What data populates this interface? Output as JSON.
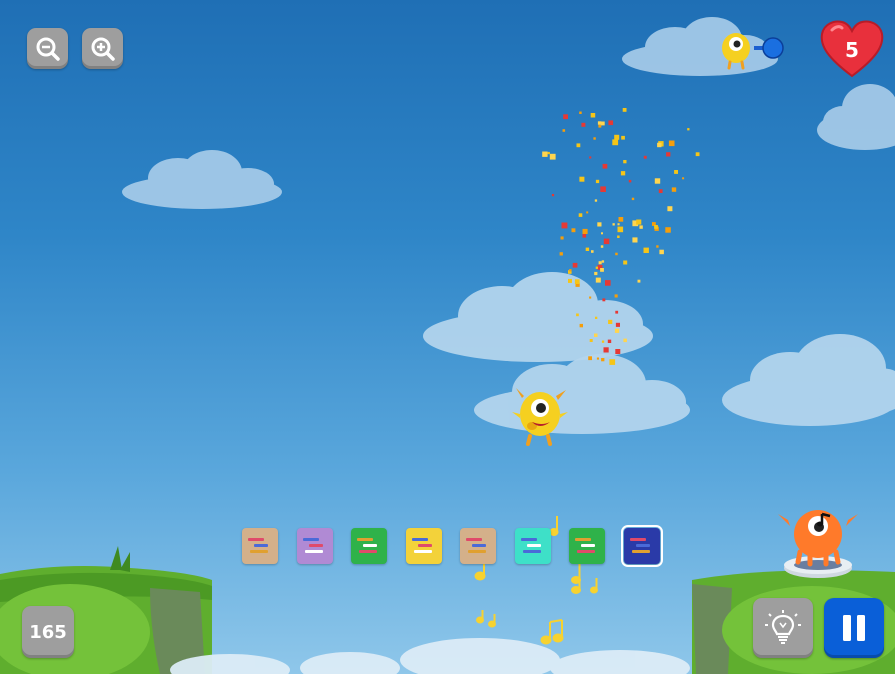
{
  "hud": {
    "zoom_out_icon": "zoom-out-icon",
    "zoom_in_icon": "zoom-in-icon",
    "lives": "5",
    "score": "165",
    "hint_icon": "lightbulb-icon",
    "pause_icon": "pause-icon",
    "progress_icon": "monster-progress-icon"
  },
  "colors": {
    "sky_top": "#1f6fb5",
    "button_gray": "#9e9e9e",
    "pause_blue": "#0a5fd8",
    "heart_red": "#e8303c",
    "ground_green": "#5fae2e"
  },
  "code_blocks": [
    {
      "name": "block-tan-1",
      "color": "#d4b08a",
      "lines": [
        "#e04a6a",
        "#4a6ad8",
        "#e0a030"
      ]
    },
    {
      "name": "block-purple",
      "color": "#b08ad4",
      "lines": [
        "#4a6ad8",
        "#e04a6a",
        "#ffffff"
      ]
    },
    {
      "name": "block-green-1",
      "color": "#2fb24a",
      "lines": [
        "#e0a030",
        "#ffffff",
        "#e04a6a"
      ]
    },
    {
      "name": "block-yellow",
      "color": "#f3d23a",
      "lines": [
        "#4a6ad8",
        "#e04a6a",
        "#ffffff"
      ]
    },
    {
      "name": "block-tan-2",
      "color": "#d4b08a",
      "lines": [
        "#e04a6a",
        "#4a6ad8",
        "#e0a030"
      ]
    },
    {
      "name": "block-teal",
      "color": "#3ee0c8",
      "lines": [
        "#4a6ad8",
        "#ffffff",
        "#4a6ad8"
      ]
    },
    {
      "name": "block-green-2",
      "color": "#2fb24a",
      "lines": [
        "#e0a030",
        "#ffffff",
        "#e04a6a"
      ]
    },
    {
      "name": "block-blue",
      "color": "#2a3aa8",
      "lines": [
        "#e04a6a",
        "#4a6ad8",
        "#e0a030"
      ]
    }
  ]
}
